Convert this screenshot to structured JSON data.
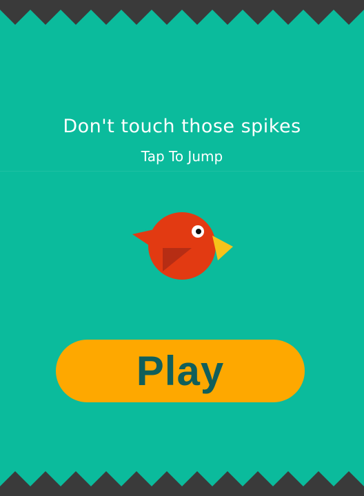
{
  "game": {
    "title": "Don't touch those spikes",
    "subtitle": "Tap To Jump",
    "play_label": "Play"
  },
  "colors": {
    "background": "#0bbb9c",
    "spikes": "#3a3a3a",
    "bird_body": "#e23a12",
    "bird_wing": "#b62d14",
    "bird_beak": "#f6c21a",
    "play_button": "#fea800",
    "play_text": "#115f5b"
  },
  "icons": {
    "bird": "red-bird-icon",
    "spikes": "spike-row"
  }
}
